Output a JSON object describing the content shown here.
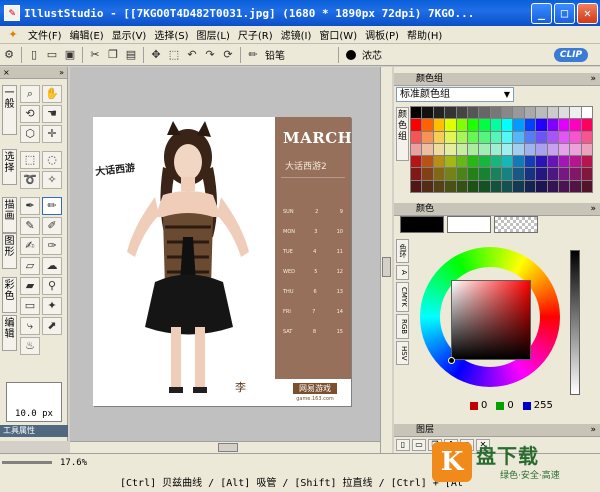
{
  "window": {
    "title": "IllustStudio - [[7KGO0T4D482T0031.jpg] (1680 * 1890px 72dpi) 7KGO...",
    "minimize": "_",
    "maximize": "□",
    "close": "✕"
  },
  "menu": {
    "items": [
      "文件(F)",
      "编辑(E)",
      "显示(V)",
      "选择(S)",
      "图层(L)",
      "尺子(R)",
      "滤镜(I)",
      "窗口(W)",
      "调板(P)",
      "帮助(H)"
    ]
  },
  "toolbar": {
    "tool_name": "铅笔",
    "brush_name": "浓芯",
    "clip_badge": "CLIP"
  },
  "left_panel": {
    "categories": [
      "一般",
      "选择",
      "描画",
      "图形",
      "彩色",
      "编辑"
    ],
    "brush_size": "10.0 px",
    "tool_props_label": "工具属性"
  },
  "document": {
    "month": "MARCH",
    "subtitle": "大话西游2",
    "brand": "大话西游",
    "signature": "李",
    "logo": "网易游戏",
    "logo_url": "game.163.com",
    "calendar": [
      [
        "SUN",
        "2",
        "9"
      ],
      [
        "MON",
        "3",
        "10"
      ],
      [
        "TUE",
        "4",
        "11"
      ],
      [
        "WED",
        "5",
        "12"
      ],
      [
        "THU",
        "6",
        "13"
      ],
      [
        "FRI",
        "7",
        "14"
      ],
      [
        "SAT",
        "8",
        "15"
      ]
    ]
  },
  "swatch_panel": {
    "title": "颜色组",
    "selected_set": "标准颜色组",
    "tab_label": "颜色组"
  },
  "color_panel": {
    "title": "颜色",
    "tabs": [
      "色环",
      "A",
      "CMYK",
      "RGB",
      "HSV"
    ],
    "r": "0",
    "g": "0",
    "b": "255",
    "colors": {
      "main": "#000000",
      "sub": "#ffffff",
      "sv_hue": "#ff0000"
    }
  },
  "layer_panel": {
    "title": "图层"
  },
  "status": {
    "zoom": "17.6%",
    "hint": "[Ctrl] 贝兹曲线 / [Alt] 吸管 / [Shift] 拉直线 / [Ctrl] + [Al"
  },
  "watermark": {
    "icon": "K",
    "text": "盘下载",
    "sub": "绿色·安全·高速"
  }
}
